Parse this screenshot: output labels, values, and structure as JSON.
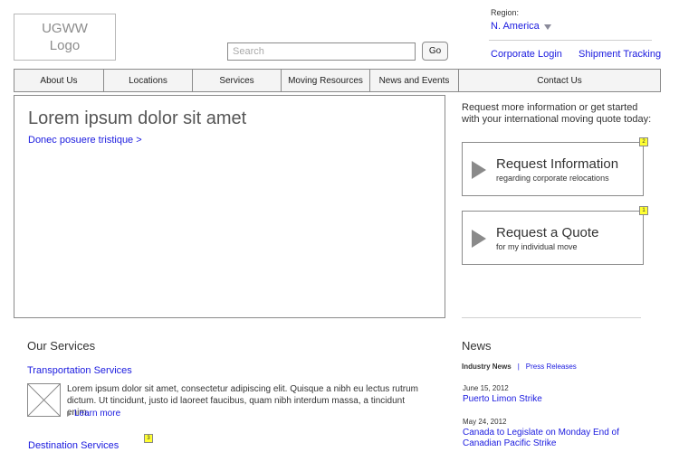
{
  "header": {
    "logo_text": "UGWW\nLogo",
    "search": {
      "placeholder": "Search",
      "button_label": "Go"
    },
    "region": {
      "label": "Region:",
      "selected": "N. America"
    },
    "links": {
      "corporate_login": "Corporate Login",
      "shipment_tracking": "Shipment Tracking"
    }
  },
  "nav": {
    "items": [
      {
        "label": "About Us"
      },
      {
        "label": "Locations"
      },
      {
        "label": "Services"
      },
      {
        "label": "Moving Resources"
      },
      {
        "label": "News and Events"
      },
      {
        "label": "Contact Us"
      }
    ]
  },
  "hero": {
    "title": "Lorem ipsum dolor sit amet",
    "link": "Donec posuere tristique >"
  },
  "sidebar": {
    "intro": "Request more information or get started with your international moving quote today:",
    "cta": [
      {
        "title": "Request Information",
        "subtitle": "regarding corporate relocations",
        "badge": "2"
      },
      {
        "title": "Request a Quote",
        "subtitle": "for my individual move",
        "badge": "1"
      }
    ]
  },
  "services": {
    "title": "Our Services",
    "items": [
      {
        "title": "Transportation Services",
        "description": "Lorem ipsum dolor sit amet, consectetur adipiscing elit. Quisque a nibh eu lectus rutrum dictum. Ut tincidunt, justo id laoreet faucibus, quam nibh interdum massa, a tincidunt enim.",
        "learn_more": "Learn more"
      },
      {
        "title": "Destination Services",
        "badge": "3"
      }
    ]
  },
  "news": {
    "title": "News",
    "tabs": {
      "active": "Industry News",
      "separator": "|",
      "other": "Press Releases"
    },
    "items": [
      {
        "date": "June 15, 2012",
        "headline": "Puerto Limon Strike"
      },
      {
        "date": "May 24, 2012",
        "headline": "Canada to Legislate on Monday End of Canadian Pacific Strike"
      }
    ]
  }
}
